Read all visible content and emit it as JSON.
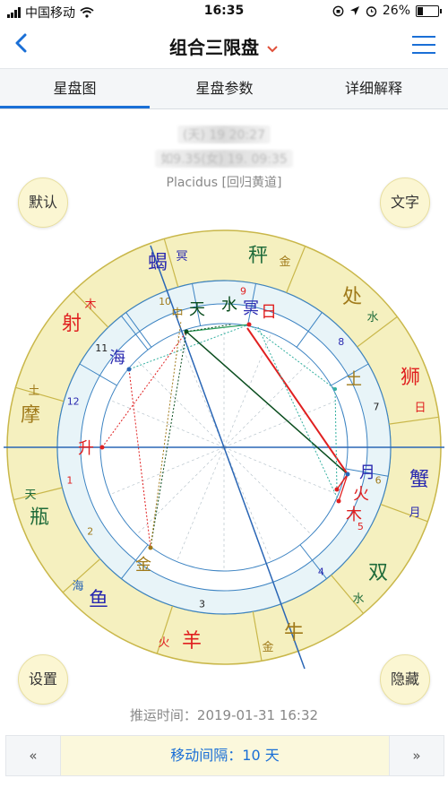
{
  "status_bar": {
    "carrier": "中国移动",
    "time": "16:35",
    "battery": "26%"
  },
  "nav": {
    "title": "组合三限盘"
  },
  "tabs": [
    {
      "label": "星盘图"
    },
    {
      "label": "星盘参数"
    },
    {
      "label": "详细解释"
    }
  ],
  "chart_info": {
    "line1": "(天) 19         20:27",
    "line2": "如9.35(女) 19.         09:35",
    "house_system": "Placidus [回归黄道]"
  },
  "buttons": {
    "default": "默认",
    "text": "文字",
    "settings": "设置",
    "hide": "隐藏"
  },
  "push_time": "推运时间：2019-01-31 16:32",
  "footer": {
    "prev": "«",
    "interval": "移动间隔：10 天",
    "next": "»"
  },
  "colors": {
    "accent": "#1a6fd6",
    "zodiac_ring": "#f5f0bf",
    "inner_ring": "#e8f4f8"
  },
  "zodiac_signs": [
    {
      "name": "秤",
      "ruler": "金"
    },
    {
      "name": "处",
      "ruler": "水"
    },
    {
      "name": "狮",
      "ruler": "日"
    },
    {
      "name": "蟹",
      "ruler": "月"
    },
    {
      "name": "双",
      "ruler": "水"
    },
    {
      "name": "牛",
      "ruler": "金"
    },
    {
      "name": "羊",
      "ruler": "火"
    },
    {
      "name": "鱼",
      "ruler": "海"
    },
    {
      "name": "瓶",
      "ruler": "天"
    },
    {
      "name": "摩",
      "ruler": "土"
    },
    {
      "name": "射",
      "ruler": "木"
    },
    {
      "name": "蝎",
      "ruler": "冥"
    }
  ],
  "house_numbers": [
    "1",
    "2",
    "3",
    "4",
    "5",
    "6",
    "7",
    "8",
    "9",
    "10",
    "11",
    "12"
  ],
  "planets": [
    {
      "name": "天"
    },
    {
      "name": "水"
    },
    {
      "name": "冥"
    },
    {
      "name": "日"
    },
    {
      "name": "海"
    },
    {
      "name": "土"
    },
    {
      "name": "升"
    },
    {
      "name": "月"
    },
    {
      "name": "火"
    },
    {
      "name": "木"
    },
    {
      "name": "金"
    },
    {
      "name": "中"
    }
  ]
}
